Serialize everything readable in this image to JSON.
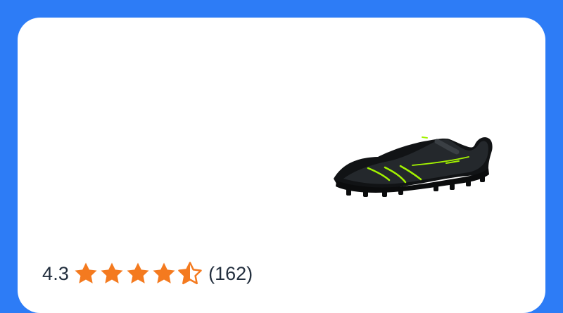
{
  "product": {
    "image_icon": "soccer-cleat-image"
  },
  "rating": {
    "value": "4.3",
    "stars": 4.3,
    "max_stars": 5,
    "count": "(162)"
  },
  "colors": {
    "background": "#2d7cf6",
    "card": "#ffffff",
    "star": "#f47a1f",
    "text": "#232f3e"
  }
}
